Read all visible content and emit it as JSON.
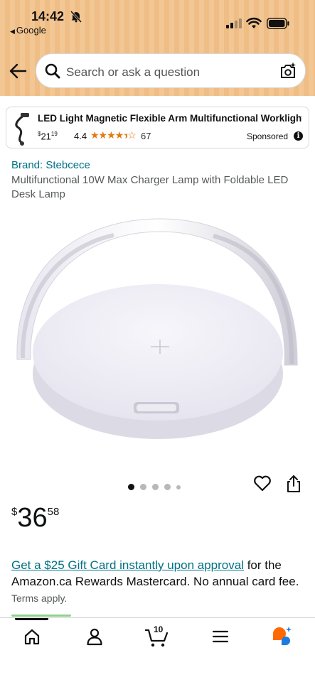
{
  "status": {
    "time": "14:42",
    "back_app": "Google"
  },
  "search": {
    "placeholder": "Search or ask a question"
  },
  "sponsored_ad": {
    "title": "LED Light Magnetic Flexible Arm Multifunctional Worklight...",
    "price_currency": "$",
    "price_whole": "21",
    "price_fraction": "19",
    "rating": "4.4",
    "stars_value": 4.4,
    "review_count": "67",
    "sponsored_label": "Sponsored"
  },
  "product": {
    "brand": "Brand: Stebcece",
    "title": "Multifunctional 10W Max Charger Lamp with Foldable LED Desk Lamp",
    "image_count": 5,
    "active_image": 1,
    "price_symbol": "$",
    "price_whole": "36",
    "price_fraction": "58"
  },
  "promo": {
    "link_text": "Get a $25 Gift Card instantly upon approval",
    "body_text": " for the Amazon.ca Rewards Mastercard. No annual card fee. ",
    "terms": "Terms apply."
  },
  "bottom_nav": {
    "items": [
      "home-icon",
      "account-icon",
      "cart-icon",
      "menu-icon",
      "rufus-icon"
    ],
    "cart_count": "10"
  },
  "colors": {
    "header_bg": "#f3c794",
    "link": "#007185",
    "star": "#e47911",
    "rufus_orange": "#ff6a00",
    "rufus_blue": "#1c7ce0"
  }
}
